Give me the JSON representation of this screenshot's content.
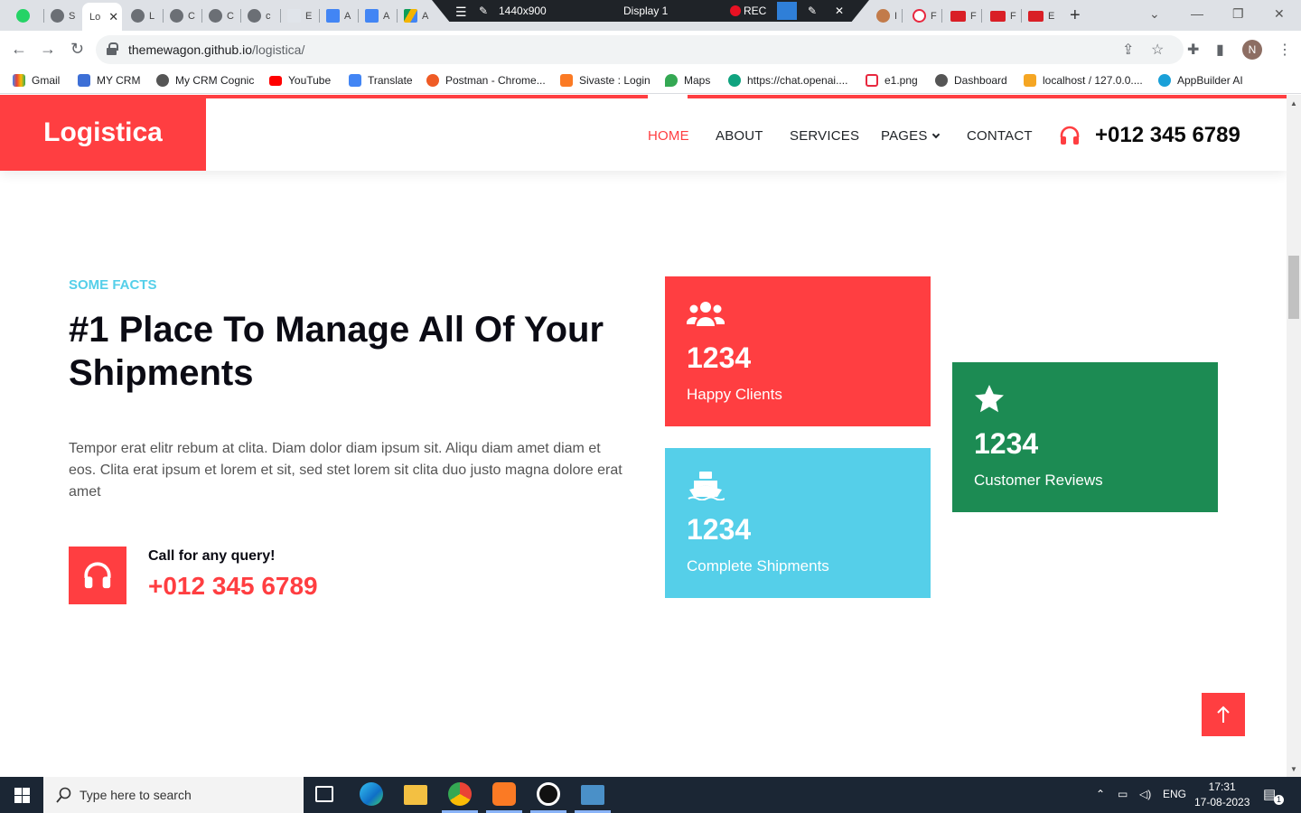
{
  "browser": {
    "tabs": [
      {
        "label": "",
        "icon": "whatsapp-icon"
      },
      {
        "label": "S",
        "icon": "globe-icon"
      },
      {
        "label": "Lo",
        "icon": "",
        "active": true
      },
      {
        "label": "L",
        "icon": "globe-icon"
      },
      {
        "label": "C",
        "icon": "globe-icon"
      },
      {
        "label": "C",
        "icon": "globe-icon"
      },
      {
        "label": "c",
        "icon": "globe-icon"
      },
      {
        "label": "E",
        "icon": "page-icon"
      },
      {
        "label": "A",
        "icon": "docs-icon"
      },
      {
        "label": "A",
        "icon": "docs-icon"
      },
      {
        "label": "A",
        "icon": "drive-icon"
      },
      {
        "label": "I",
        "icon": "avatar-icon"
      },
      {
        "label": "F",
        "icon": "d-icon"
      },
      {
        "label": "F",
        "icon": "mb-icon"
      },
      {
        "label": "F",
        "icon": "mb-icon"
      },
      {
        "label": "E",
        "icon": "mb-icon"
      }
    ],
    "recorder": {
      "size": "1440x900",
      "display": "Display 1",
      "rec": "REC"
    },
    "url_host": "themewagon.github.io",
    "url_path": "/logistica/",
    "profile_initial": "N",
    "bookmarks": [
      "Gmail",
      "MY CRM",
      "My CRM Cognic",
      "YouTube",
      "Translate",
      "Postman - Chrome...",
      "Sivaste : Login",
      "Maps",
      "https://chat.openai....",
      "e1.png",
      "Dashboard",
      "localhost / 127.0.0....",
      "AppBuilder AI"
    ]
  },
  "site": {
    "brand": "Logistica",
    "nav": [
      "HOME",
      "ABOUT",
      "SERVICES",
      "PAGES",
      "CONTACT"
    ],
    "header_phone": "+012 345 6789",
    "eyebrow": "SOME FACTS",
    "headline": "#1 Place To Manage All Of Your Shipments",
    "paragraph": "Tempor erat elitr rebum at clita. Diam dolor diam ipsum sit. Aliqu diam amet diam et eos. Clita erat ipsum et lorem et sit, sed stet lorem sit clita duo justo magna dolore erat amet",
    "call_label": "Call for any query!",
    "call_number": "+012 345 6789",
    "facts": [
      {
        "number": "1234",
        "label": "Happy Clients",
        "icon": "users-icon",
        "color": "#ff3e41"
      },
      {
        "number": "1234",
        "label": "Complete Shipments",
        "icon": "ship-icon",
        "color": "#55cfe9"
      },
      {
        "number": "1234",
        "label": "Customer Reviews",
        "icon": "star-icon",
        "color": "#1c8b53"
      }
    ],
    "accent": "#ff3e41"
  },
  "taskbar": {
    "search_placeholder": "Type here to search",
    "language": "ENG",
    "time": "17:31",
    "date": "17-08-2023",
    "notification_count": "1"
  }
}
